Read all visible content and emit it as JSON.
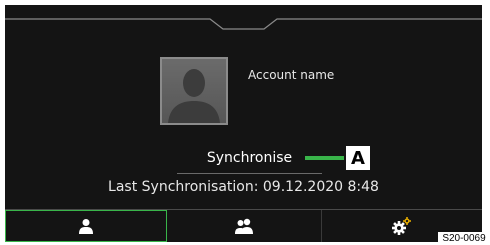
{
  "profile": {
    "account_name": "Account name"
  },
  "actions": {
    "synchronise_label": "Synchronise"
  },
  "status": {
    "last_sync": "Last Synchronisation: 09.12.2020 8:48"
  },
  "callout": {
    "letter": "A"
  },
  "tabs": [
    {
      "icon": "user-icon",
      "selected": true
    },
    {
      "icon": "users-icon",
      "selected": false
    },
    {
      "icon": "settings-icon",
      "selected": false
    }
  ],
  "figure_code": "S20-0069",
  "colors": {
    "screen_bg": "#141414",
    "accent": "#39b54a",
    "text": "#e8e8e8"
  }
}
